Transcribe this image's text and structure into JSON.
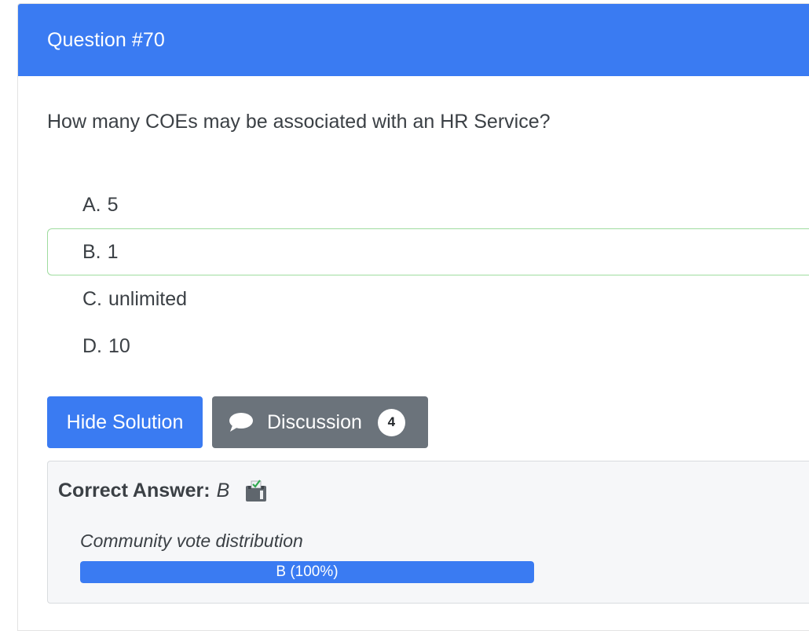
{
  "header": {
    "title": "Question #70"
  },
  "question": {
    "text": "How many COEs may be associated with an HR Service?"
  },
  "choices": [
    {
      "letter": "A.",
      "text": "5",
      "correct": false
    },
    {
      "letter": "B.",
      "text": "1",
      "correct": true
    },
    {
      "letter": "C.",
      "text": "unlimited",
      "correct": false
    },
    {
      "letter": "D.",
      "text": "10",
      "correct": false
    }
  ],
  "buttons": {
    "hide_solution": "Hide Solution",
    "discussion": "Discussion",
    "discussion_count": "4",
    "discussion_icon": "speech-bubble-icon"
  },
  "solution": {
    "label": "Correct Answer:",
    "value": "B",
    "icon": "voted-ballot-icon",
    "vote_title": "Community vote distribution",
    "vote_bar_label": "B (100%)",
    "vote_fraction": 1.0
  },
  "colors": {
    "primary": "#3a7bf2",
    "secondary": "#6b737b",
    "correct_border": "#9fdc9f"
  }
}
